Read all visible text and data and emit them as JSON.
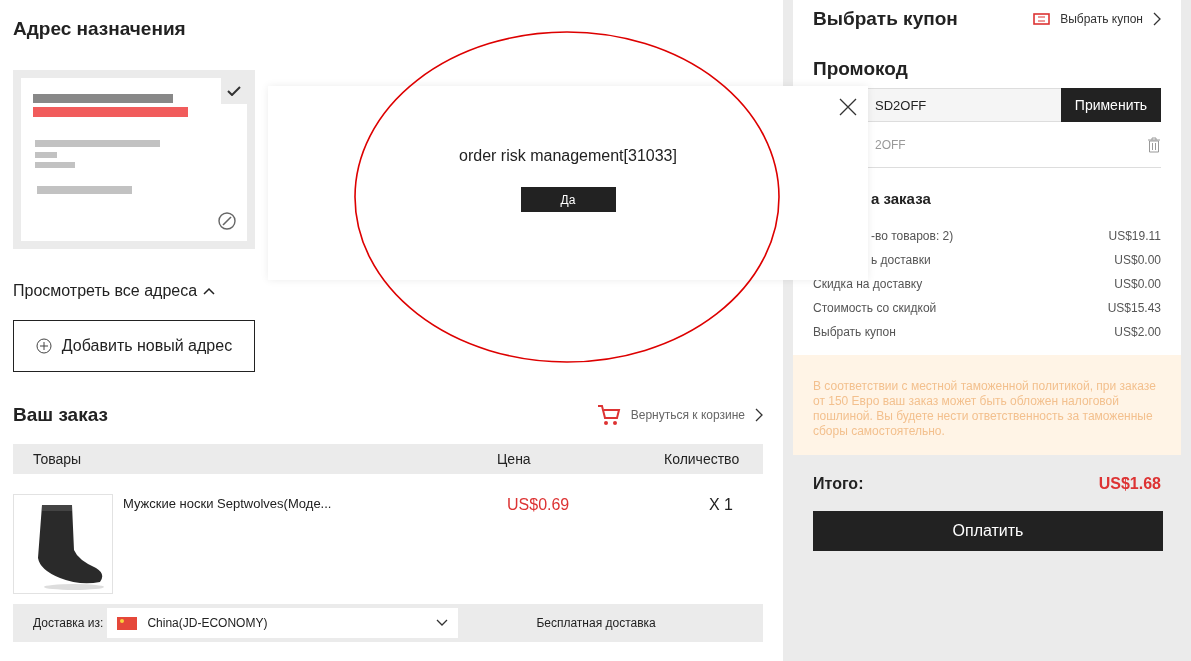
{
  "address": {
    "title": "Адрес назначения",
    "selected": true,
    "view_all": "Просмотреть все адреса",
    "add_button": "Добавить новый адрес"
  },
  "order": {
    "title": "Ваш заказ",
    "back_link": "Вернуться к корзине",
    "columns": [
      "Товары",
      "Цена",
      "Количество"
    ],
    "items": [
      {
        "name": "Мужские носки Septwolves(Моде...",
        "price": "US$0.69",
        "quantity": "X 1",
        "ship_label": "Доставка из:",
        "ship_from": "China(JD-ECONOMY)",
        "shipping": "Бесплатная доставка"
      }
    ]
  },
  "coupon": {
    "title": "Выбрать купон",
    "link": "Выбрать купон"
  },
  "promo": {
    "title": "Промокод",
    "value": "SD2OFF",
    "apply": "Применить",
    "applied": "2OFF"
  },
  "summary": {
    "title": "а заказа",
    "rows": [
      {
        "label": "-во товаров: 2)",
        "value": "US$19.11",
        "kind": "partial"
      },
      {
        "label": "ь доставки",
        "value": "US$0.00",
        "kind": "partial"
      },
      {
        "label": "Скидка на доставку",
        "value": "US$0.00",
        "kind": "full"
      },
      {
        "label": "Стоимость со скидкой",
        "value": "US$15.43",
        "kind": "full"
      },
      {
        "label": "Выбрать купон",
        "value": "US$2.00",
        "kind": "full"
      }
    ]
  },
  "notice": "В соответствии с местной таможенной политикой, при заказе от 150 Евро ваш заказ может быть обложен налоговой пошлиной. Вы будете нести ответственность за таможенные сборы самостоятельно.",
  "total": {
    "label": "Итого:",
    "value": "US$1.68",
    "pay": "Оплатить"
  },
  "dialog": {
    "message": "order risk management[31033]",
    "ok": "Да"
  }
}
